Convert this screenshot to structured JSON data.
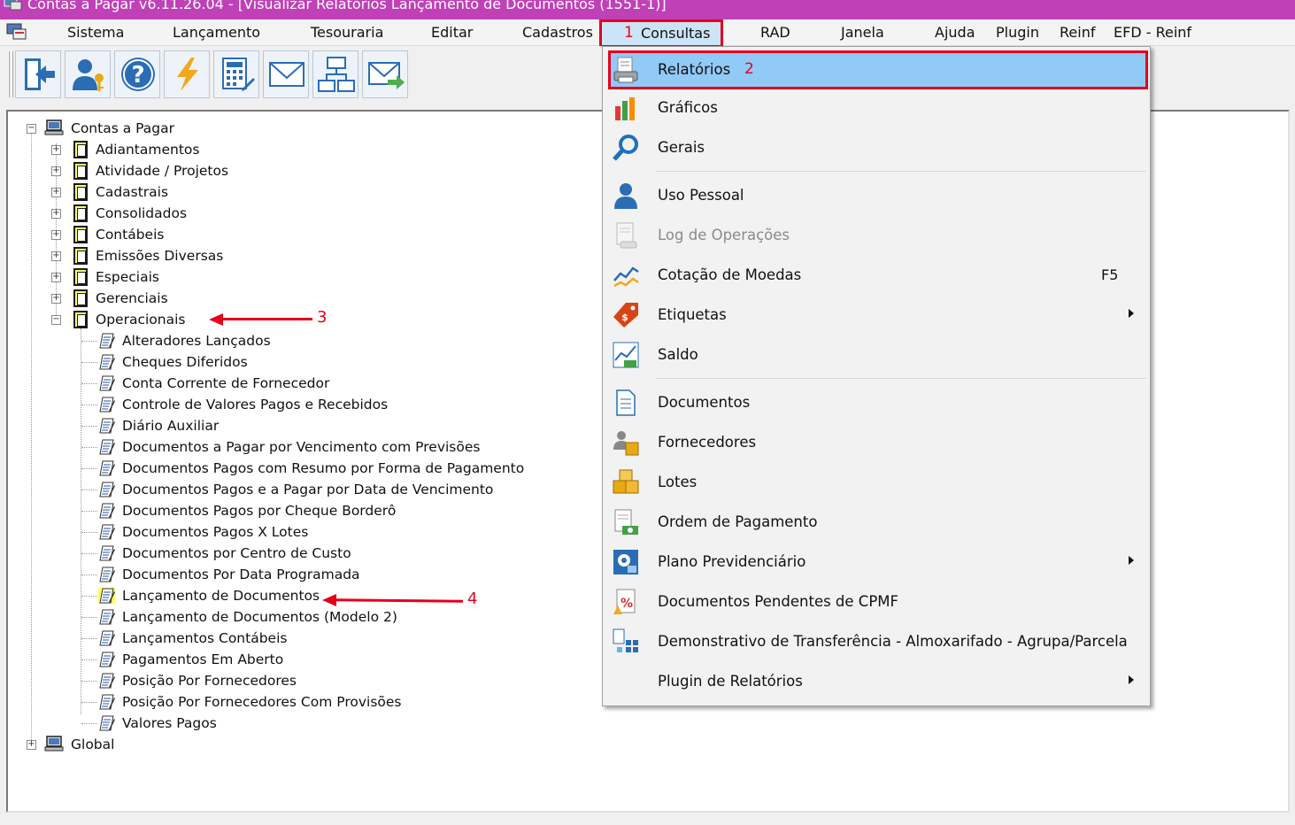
{
  "window": {
    "title": "Contas a Pagar v6.11.26.04 - [Visualizar Relatórios Lançamento de Documentos (1551-1)]"
  },
  "menubar": {
    "items": [
      "Sistema",
      "Lançamento",
      "Tesouraria",
      "Editar",
      "Cadastros",
      "Consultas",
      "RAD",
      "Janela",
      "Ajuda",
      "Plugin",
      "Reinf",
      "EFD - Reinf"
    ]
  },
  "toolbar": {
    "buttons": [
      "exit-icon",
      "user-key-icon",
      "help-icon",
      "lightning-icon",
      "calculator-edit-icon",
      "mail-icon",
      "network-icon",
      "mail-send-icon"
    ]
  },
  "tree": {
    "root": "Contas a Pagar",
    "folders": [
      "Adiantamentos",
      "Atividade / Projetos",
      "Cadastrais",
      "Consolidados",
      "Contábeis",
      "Emissões Diversas",
      "Especiais",
      "Gerenciais",
      "Operacionais"
    ],
    "operacionais_children": [
      "Alteradores Lançados",
      "Cheques Diferidos",
      "Conta Corrente de Fornecedor",
      "Controle de Valores Pagos e Recebidos",
      "Diário Auxiliar",
      "Documentos a Pagar por Vencimento com Previsões",
      "Documentos Pagos com Resumo por Forma de Pagamento",
      "Documentos Pagos e a Pagar por Data de Vencimento",
      "Documentos Pagos por Cheque Borderô",
      "Documentos Pagos X Lotes",
      "Documentos por Centro de Custo",
      "Documentos Por Data Programada",
      "Lançamento de Documentos",
      "Lançamento de Documentos (Modelo 2)",
      "Lançamentos Contábeis",
      "Pagamentos Em Aberto",
      "Posição Por Fornecedores",
      "Posição Por Fornecedores Com Provisões",
      "Valores Pagos"
    ],
    "global": "Global"
  },
  "dropdown": {
    "items": [
      {
        "label": "Relatórios",
        "icon": "report-printer-icon",
        "shortcut": "",
        "submenu": false,
        "disabled": false
      },
      {
        "label": "Gráficos",
        "icon": "bar-chart-icon",
        "shortcut": "",
        "submenu": false,
        "disabled": false
      },
      {
        "label": "Gerais",
        "icon": "magnifier-icon",
        "shortcut": "",
        "submenu": false,
        "disabled": false
      },
      {
        "label": "Uso Pessoal",
        "icon": "person-icon",
        "shortcut": "",
        "submenu": false,
        "disabled": false
      },
      {
        "label": "Log de Operações",
        "icon": "log-icon",
        "shortcut": "",
        "submenu": false,
        "disabled": true
      },
      {
        "label": "Cotação de Moedas",
        "icon": "currency-chart-icon",
        "shortcut": "F5",
        "submenu": false,
        "disabled": false
      },
      {
        "label": "Etiquetas",
        "icon": "tag-icon",
        "shortcut": "",
        "submenu": true,
        "disabled": false
      },
      {
        "label": "Saldo",
        "icon": "balance-chart-icon",
        "shortcut": "",
        "submenu": false,
        "disabled": false
      },
      {
        "label": "Documentos",
        "icon": "document-icon",
        "shortcut": "",
        "submenu": false,
        "disabled": false
      },
      {
        "label": "Fornecedores",
        "icon": "suppliers-icon",
        "shortcut": "",
        "submenu": false,
        "disabled": false
      },
      {
        "label": "Lotes",
        "icon": "boxes-icon",
        "shortcut": "",
        "submenu": false,
        "disabled": false
      },
      {
        "label": "Ordem de Pagamento",
        "icon": "payment-order-icon",
        "shortcut": "",
        "submenu": false,
        "disabled": false
      },
      {
        "label": "Plano Previdenciário",
        "icon": "pension-plan-icon",
        "shortcut": "",
        "submenu": true,
        "disabled": false
      },
      {
        "label": "Documentos Pendentes de CPMF",
        "icon": "percent-document-icon",
        "shortcut": "",
        "submenu": false,
        "disabled": false
      },
      {
        "label": "Demonstrativo de Transferência - Almoxarifado - Agrupa/Parcela",
        "icon": "transfer-icon",
        "shortcut": "",
        "submenu": false,
        "disabled": false
      },
      {
        "label": "Plugin de Relatórios",
        "icon": "",
        "shortcut": "",
        "submenu": true,
        "disabled": false
      }
    ]
  },
  "annotations": {
    "badge_1": "1",
    "badge_2": "2",
    "badge_3": "3",
    "badge_4": "4",
    "color": "#e4001c"
  }
}
